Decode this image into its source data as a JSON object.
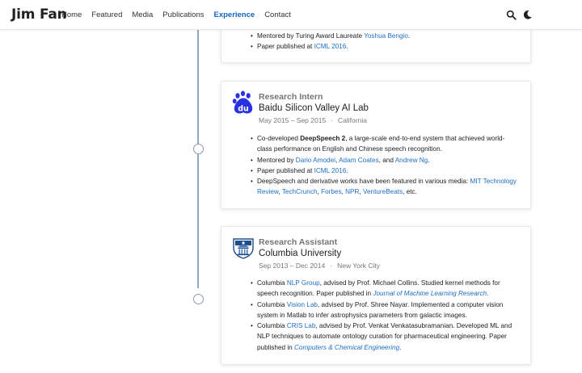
{
  "nav": {
    "brand": "Jim Fan",
    "links": [
      "Home",
      "Featured",
      "Media",
      "Publications",
      "Experience",
      "Contact"
    ],
    "active": "Experience",
    "icons": [
      "search-icon",
      "moon-icon"
    ]
  },
  "colors": {
    "link": "#1e6ec8",
    "active_nav": "#1565c0",
    "baidu_blue": "#2932e1",
    "columbia_blue": "#1f4e8c"
  },
  "card0": {
    "items": [
      {
        "pre": "Mentored by Turing Award Laureate ",
        "link": "Yoshua Bengio",
        "post": "."
      },
      {
        "pre": "Paper published at ",
        "link": "ICML 2016",
        "post": "."
      }
    ]
  },
  "card1": {
    "role": "Research Intern",
    "org": "Baidu Silicon Valley AI Lab",
    "dates": "May 2015 – Sep 2015",
    "location": "California",
    "item1": {
      "pre": "Co-developed ",
      "bold": "DeepSpeech 2",
      "post": ", a large-scale end-to-end system that achieved world-class performance on English and Chinese speech recognition."
    },
    "item2": {
      "pre": "Mentored by ",
      "l1": "Dario Amodei",
      "sep1": ", ",
      "l2": "Adam Coates",
      "sep2": ", and ",
      "l3": "Andrew Ng",
      "post": "."
    },
    "item3": {
      "pre": "Paper published at ",
      "link": "ICML 2016",
      "post": "."
    },
    "item4": {
      "pre": "DeepSpeech and derivative works have been featured in various media: ",
      "l1": "MIT Technology Review",
      "s1": ", ",
      "l2": "TechCrunch",
      "s2": ", ",
      "l3": "Forbes",
      "s3": ", ",
      "l4": "NPR",
      "s4": ", ",
      "l5": "VentureBeats",
      "post": ", etc."
    }
  },
  "card2": {
    "role": "Research Assistant",
    "org": "Columbia University",
    "dates": "Sep 2013 – Dec 2014",
    "location": "New York City",
    "item1": {
      "pre": "Columbia ",
      "link": "NLP Group",
      "mid": ", advised by Prof. Michael Collins. Studied kernel methods for speech recognition. Paper published in ",
      "em": "Journal of Machine Learning Research",
      "post": "."
    },
    "item2": {
      "pre": "Columbia ",
      "link": "Vision Lab",
      "mid": ", advised by Prof. Shree Nayar. Implemented a computer vision system in Matlab to infer astrophysics parameters from galactic images."
    },
    "item3": {
      "pre": "Columbia ",
      "link": "CRIS Lab",
      "mid": ", advised by Prof. Venkat Venkatasubramanian. Developed ML and NLP techniques to automate ontology curation for pharmaceutical engineering. Paper published in ",
      "em": "Computers & Chemical Engineering",
      "post": "."
    }
  }
}
